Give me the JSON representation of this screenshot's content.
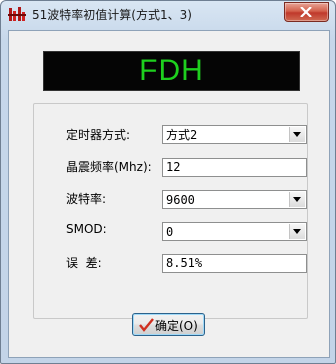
{
  "window": {
    "title": "51波特率初值计算(方式1、3)"
  },
  "display": {
    "text": "FDH",
    "color": "#1ed01e",
    "background": "#050505"
  },
  "form": {
    "timer_mode": {
      "label": "定时器方式:",
      "value": "方式2"
    },
    "crystal_freq": {
      "label": "晶震频率(Mhz):",
      "value": "12"
    },
    "baud_rate": {
      "label": "波特率:",
      "value": "9600"
    },
    "smod": {
      "label": "SMOD:",
      "value": "0"
    },
    "error": {
      "label": "误  差:",
      "value": "8.51%"
    }
  },
  "ok_button": {
    "label": "确定(O)"
  },
  "icons": {
    "app": "app-icon",
    "close": "close-icon",
    "dropdown": "chevron-down-icon",
    "ok": "checkmark-icon"
  },
  "colors": {
    "close_button": "#c0392b",
    "checkmark": "#d03020"
  }
}
